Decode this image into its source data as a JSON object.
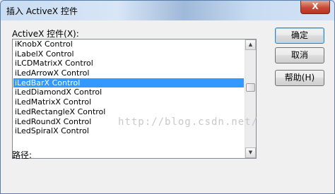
{
  "window": {
    "title": "插入 ActiveX 控件",
    "close_label": "X"
  },
  "list": {
    "label": "ActiveX 控件(X):",
    "items": [
      {
        "label": "iKnobX Control"
      },
      {
        "label": "iLabelX Control"
      },
      {
        "label": "iLCDMatrixX Control"
      },
      {
        "label": "iLedArrowX Control"
      },
      {
        "label": "iLedBarX Control"
      },
      {
        "label": "iLedDiamondX Control"
      },
      {
        "label": "iLedMatrixX Control"
      },
      {
        "label": "iLedRectangleX Control"
      },
      {
        "label": "iLedRoundX Control"
      },
      {
        "label": "iLedSpiralX Control"
      }
    ],
    "selected_index": 4
  },
  "buttons": {
    "ok": "确定",
    "cancel": "取消",
    "help": "帮助(H)"
  },
  "path": {
    "label": "路径:"
  },
  "watermark": "http://blog.csdn.net/",
  "colors": {
    "selection": "#3399ff",
    "close_button": "#c74a36"
  }
}
